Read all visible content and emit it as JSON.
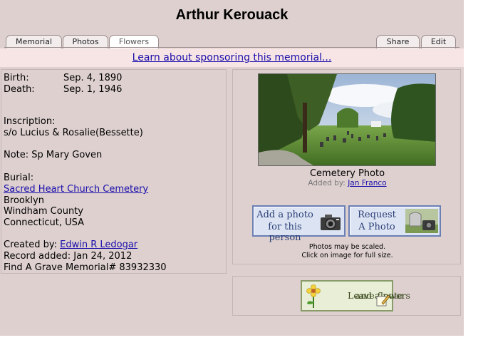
{
  "name": "Arthur Kerouack",
  "tabs": {
    "memorial": "Memorial",
    "photos": "Photos",
    "flowers": "Flowers",
    "share": "Share",
    "edit": "Edit"
  },
  "sponsor_link": "Learn about sponsoring this memorial...",
  "birth": {
    "label": "Birth:",
    "value": "Sep. 4, 1890"
  },
  "death": {
    "label": "Death:",
    "value": "Sep. 1, 1946"
  },
  "inscription": {
    "label": "Inscription:",
    "value": "s/o Lucius & Rosalie(Bessette)"
  },
  "note": "Note: Sp Mary Goven",
  "burial": {
    "label": "Burial:",
    "cemetery": "Sacred Heart Church Cemetery",
    "city": "Brooklyn",
    "county": "Windham County",
    "state": "Connecticut, USA"
  },
  "created_by": {
    "label": "Created by:",
    "name": "Edwin R Ledogar"
  },
  "record_added": "Record added: Jan 24, 2012",
  "memorial_id": "Find A Grave Memorial# 83932330",
  "photo": {
    "caption": "Cemetery Photo",
    "added_by_label": "Added by:",
    "added_by": "Jan Franco",
    "scaled_note": "Photos may be scaled.",
    "click_note": "Click on image for full size."
  },
  "buttons": {
    "add_photo_line1": "Add a photo",
    "add_photo_line2": "for this person",
    "request_line1": "Request",
    "request_line2": "A Photo",
    "flowers_line1": "Leave flowers",
    "flowers_line2": "and a note"
  },
  "colors": {
    "background": "#ddd0cf",
    "sponsor_bar": "#f7e4e4",
    "link": "#1a0dab",
    "photo_button": "#dce4f4",
    "flower_button": "#e8efd6"
  }
}
